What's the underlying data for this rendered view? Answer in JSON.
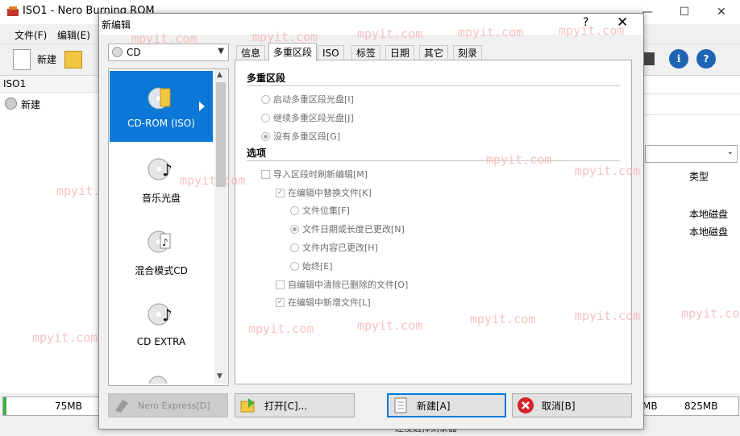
{
  "main_window": {
    "title": "ISO1 - Nero Burning ROM",
    "menu": [
      {
        "label": "文件(F)"
      },
      {
        "label": "编辑(E)"
      }
    ],
    "toolbar_new_label": "新建",
    "left_header": "ISO1",
    "tree_item": "新建",
    "right_column_header": "类型",
    "right_rows": [
      "本地磁盘",
      "本地磁盘"
    ],
    "capacity_ticks": [
      "75MB",
      "MB",
      "825MB"
    ],
    "status_text": "还没选择刻录器"
  },
  "watermark": "mpyit.com",
  "dialog": {
    "title": "新编辑",
    "help": "?",
    "close": "✕",
    "disc_combo": "CD",
    "types": [
      {
        "label": "CD-ROM (ISO)",
        "icon": "cdrom-iso-icon"
      },
      {
        "label": "音乐光盘",
        "icon": "music-disc-icon"
      },
      {
        "label": "混合模式CD",
        "icon": "mixed-mode-cd-icon"
      },
      {
        "label": "CD EXTRA",
        "icon": "cd-extra-icon"
      }
    ],
    "tabs": [
      "信息",
      "多重区段",
      "ISO",
      "标签",
      "日期",
      "其它",
      "刻录"
    ],
    "active_tab": "多重区段",
    "multisession": {
      "heading": "多重区段",
      "options": [
        {
          "label": "启动多重区段光盘[I]",
          "checked": false
        },
        {
          "label": "继续多重区段光盘[J]",
          "checked": false
        },
        {
          "label": "没有多重区段[G]",
          "checked": true
        }
      ]
    },
    "options": {
      "heading": "选项",
      "refresh_on_import": {
        "label": "导入区段时刷新编辑[M]",
        "checked": false
      },
      "replace_files": {
        "label": "在编辑中替换文件[K]",
        "checked": true
      },
      "replace_modes": [
        {
          "label": "文件位集[F]",
          "checked": false
        },
        {
          "label": "文件日期或长度已更改[N]",
          "checked": true
        },
        {
          "label": "文件内容已更改[H]",
          "checked": false
        },
        {
          "label": "始终[E]",
          "checked": false
        }
      ],
      "clear_deleted": {
        "label": "自编辑中清除已删除的文件[O]",
        "checked": false
      },
      "add_new": {
        "label": "在编辑中新增文件[L]",
        "checked": true
      }
    },
    "buttons": {
      "nero_express": "Nero Express[D]",
      "open": "打开[C]...",
      "new": "新建[A]",
      "cancel": "取消[B]"
    }
  }
}
